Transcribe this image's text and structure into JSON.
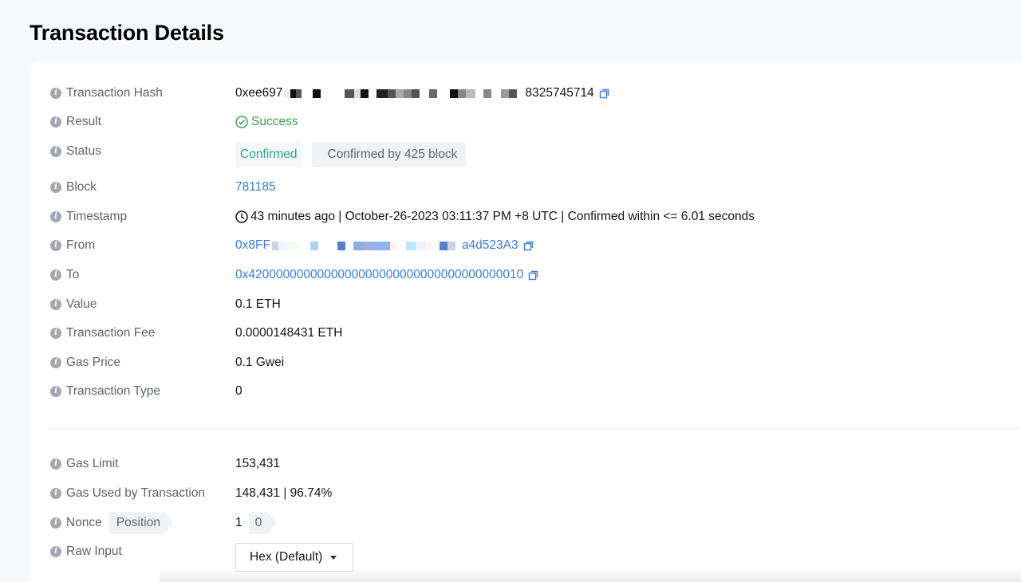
{
  "page_title": "Transaction Details",
  "fields": {
    "hash": {
      "label": "Transaction Hash",
      "prefix": "0xee697",
      "suffix": "8325745714"
    },
    "result": {
      "label": "Result",
      "value": "Success"
    },
    "status": {
      "label": "Status",
      "tag": "Confirmed",
      "blocks": "Confirmed by 425 block"
    },
    "block": {
      "label": "Block",
      "value": "781185"
    },
    "timestamp": {
      "label": "Timestamp",
      "value": "43 minutes ago | October-26-2023 03:11:37 PM +8 UTC | Confirmed within <= 6.01 seconds"
    },
    "from": {
      "label": "From",
      "prefix": "0x8FF",
      "suffix": "a4d523A3"
    },
    "to": {
      "label": "To",
      "value": "0x4200000000000000000000000000000000000010"
    },
    "value": {
      "label": "Value",
      "value": "0.1 ETH"
    },
    "fee": {
      "label": "Transaction Fee",
      "value": "0.0000148431 ETH"
    },
    "gas_price": {
      "label": "Gas Price",
      "value": "0.1 Gwei"
    },
    "tx_type": {
      "label": "Transaction Type",
      "value": "0"
    },
    "gas_limit": {
      "label": "Gas Limit",
      "value": "153,431"
    },
    "gas_used": {
      "label": "Gas Used by Transaction",
      "value": "148,431 | 96.74%"
    },
    "nonce": {
      "label": "Nonce",
      "position_label": "Position",
      "value": "1",
      "position_value": "0"
    },
    "raw_input": {
      "label": "Raw Input",
      "selected": "Hex (Default)"
    }
  },
  "colors": {
    "link": "#3b7ddd",
    "success": "#3aa14a",
    "confirmed": "#2aa68f"
  },
  "icons": [
    "info-icon",
    "copy-icon",
    "check-circle-icon",
    "clock-icon",
    "caret-down-icon"
  ]
}
